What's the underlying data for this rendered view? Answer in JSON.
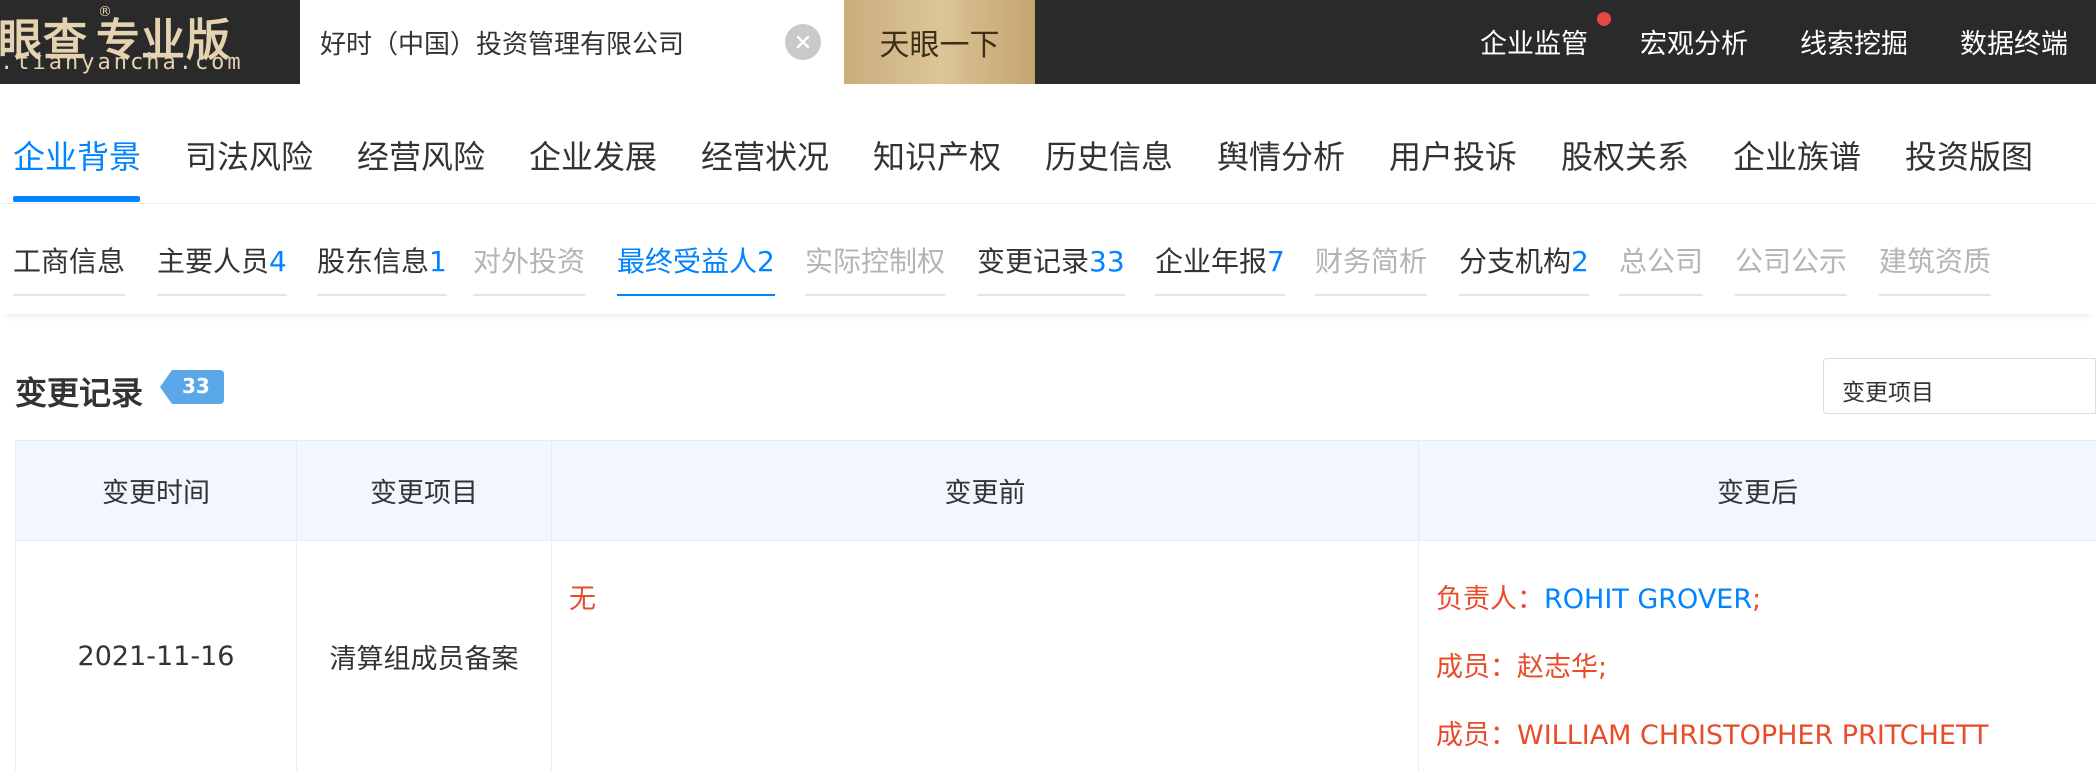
{
  "header": {
    "logo_main": "眼查",
    "logo_reg": "®",
    "logo_tag": "专业版",
    "logo_domain": ".tianyancha.com",
    "search_value": "好时（中国）投资管理有限公司",
    "search_button": "天眼一下",
    "nav": [
      "企业监管",
      "宏观分析",
      "线索挖掘",
      "数据终端"
    ]
  },
  "tabs": [
    "企业背景",
    "司法风险",
    "经营风险",
    "企业发展",
    "经营状况",
    "知识产权",
    "历史信息",
    "舆情分析",
    "用户投诉",
    "股权关系",
    "企业族谱",
    "投资版图"
  ],
  "active_tab": "企业背景",
  "subtabs": [
    {
      "label": "工商信息",
      "count": ""
    },
    {
      "label": "主要人员",
      "count": "4"
    },
    {
      "label": "股东信息",
      "count": "1"
    },
    {
      "label": "对外投资",
      "count": ""
    },
    {
      "label": "最终受益人",
      "count": "2"
    },
    {
      "label": "实际控制权",
      "count": ""
    },
    {
      "label": "变更记录",
      "count": "33"
    },
    {
      "label": "企业年报",
      "count": "7"
    },
    {
      "label": "财务简析",
      "count": ""
    },
    {
      "label": "分支机构",
      "count": "2"
    },
    {
      "label": "总公司",
      "count": ""
    },
    {
      "label": "公司公示",
      "count": ""
    },
    {
      "label": "建筑资质",
      "count": ""
    }
  ],
  "section": {
    "title": "变更记录",
    "count": "33",
    "filter_label": "变更项目"
  },
  "table": {
    "headers": [
      "变更时间",
      "变更项目",
      "变更前",
      "变更后"
    ],
    "rows": [
      {
        "time": "2021-11-16",
        "item": "清算组成员备案",
        "before": "无",
        "after": [
          {
            "label": "负责人：",
            "value": "ROHIT GROVER",
            "suffix": ";"
          },
          {
            "label": "成员：",
            "value": "赵志华;",
            "suffix": ""
          },
          {
            "label": "成员：",
            "value": "WILLIAM CHRISTOPHER PRITCHETT",
            "suffix": ""
          }
        ]
      }
    ]
  },
  "colors": {
    "topbar": "#2a2a2a",
    "accent_blue": "#0084ff",
    "search_gold": "#d4bc8c",
    "change_red": "#e84c2a",
    "notif_red": "#e84545",
    "table_header_bg": "#f2f7ff"
  },
  "icons": [
    "clear-icon",
    "dropdown-chevron-icon",
    "notification-dot"
  ]
}
